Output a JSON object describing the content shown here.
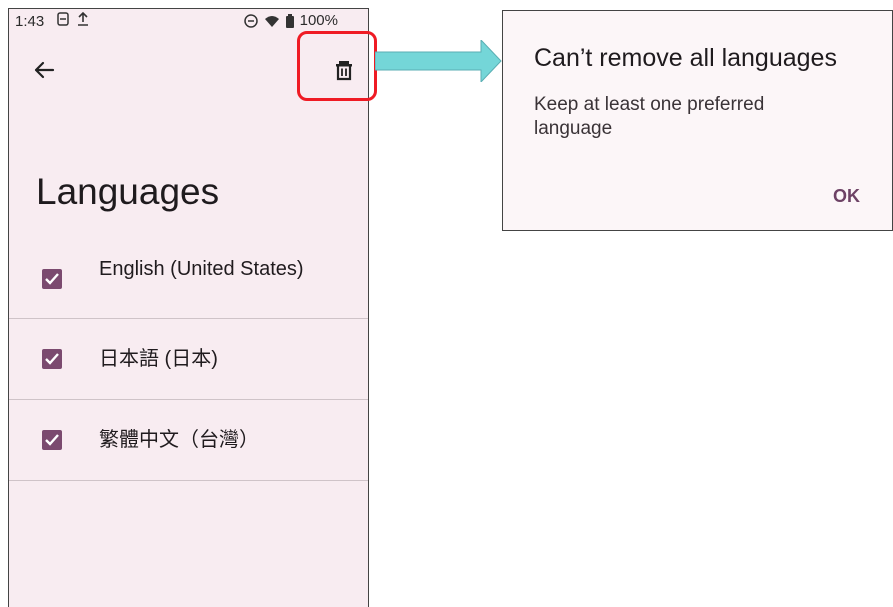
{
  "status_bar": {
    "time": "1:43",
    "battery": "100%"
  },
  "header": {
    "title": "Languages"
  },
  "languages": [
    {
      "label": "English (United States)",
      "checked": true
    },
    {
      "label": "日本語 (日本)",
      "checked": true
    },
    {
      "label": "繁體中文（台灣）",
      "checked": true
    }
  ],
  "dialog": {
    "title": "Can’t remove all languages",
    "message": "Keep at least one preferred language",
    "ok_label": "OK"
  },
  "colors": {
    "accent": "#7b4a6f",
    "background": "#f8ecf1",
    "highlight": "#ef1b24",
    "arrow": "#74d6d8"
  },
  "icons": {
    "back": "arrow-left-icon",
    "delete": "trash-icon"
  }
}
